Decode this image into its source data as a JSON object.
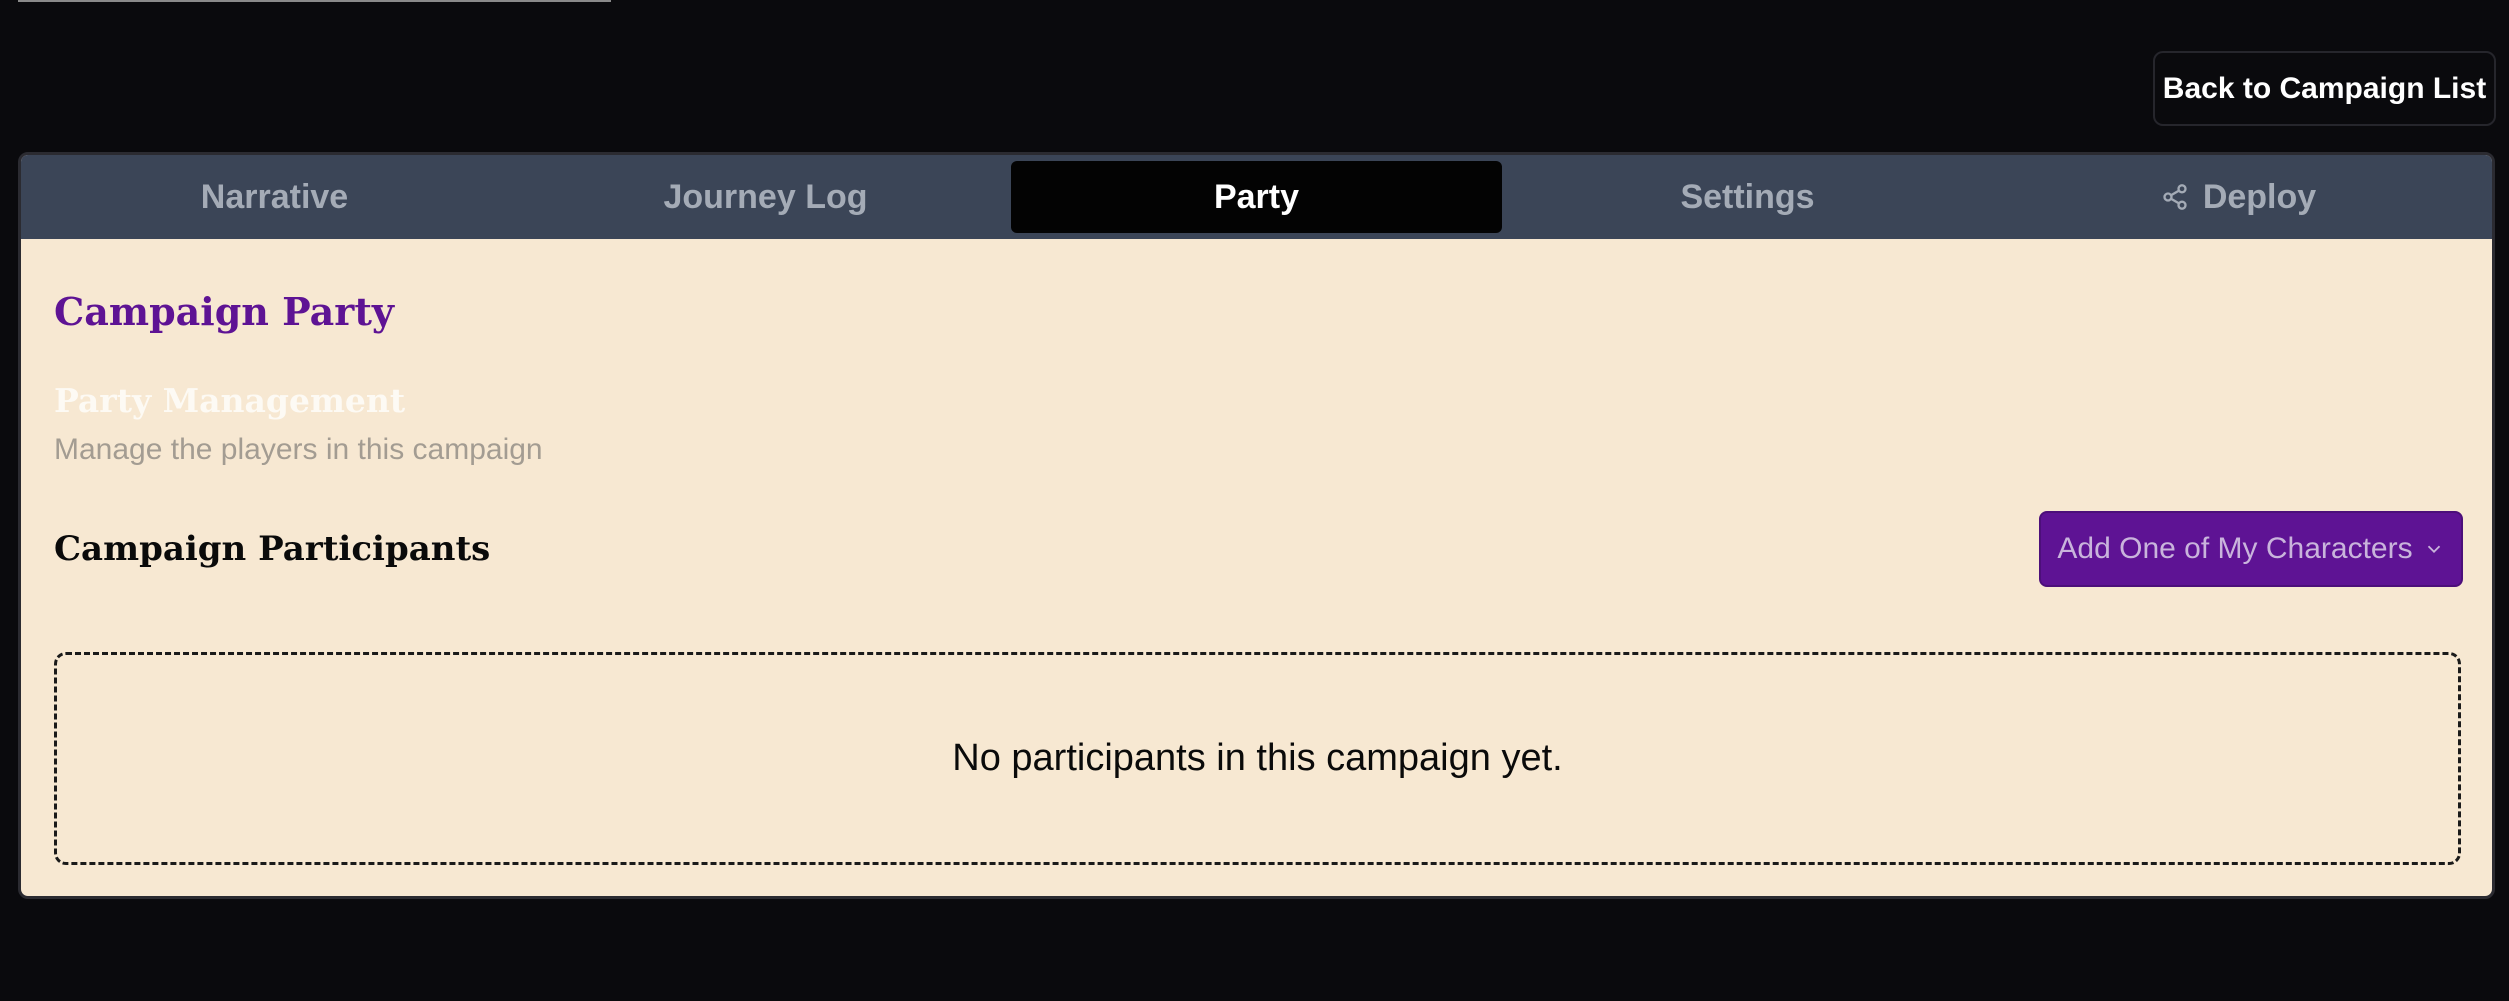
{
  "header": {
    "back_label": "Back to Campaign List"
  },
  "tabs": [
    {
      "label": "Narrative"
    },
    {
      "label": "Journey Log"
    },
    {
      "label": "Party",
      "active": true
    },
    {
      "label": "Settings"
    },
    {
      "label": "Deploy",
      "icon": "share-icon"
    }
  ],
  "main": {
    "title": "Campaign Party",
    "section_title": "Party Management",
    "section_subtitle": "Manage the players in this campaign",
    "participants_title": "Campaign Participants",
    "add_button_label": "Add One of My Characters",
    "empty_message": "No participants in this campaign yet."
  },
  "colors": {
    "accent": "#5e1394",
    "panel": "#f7e8d2",
    "tabbar": "#3b4557"
  }
}
